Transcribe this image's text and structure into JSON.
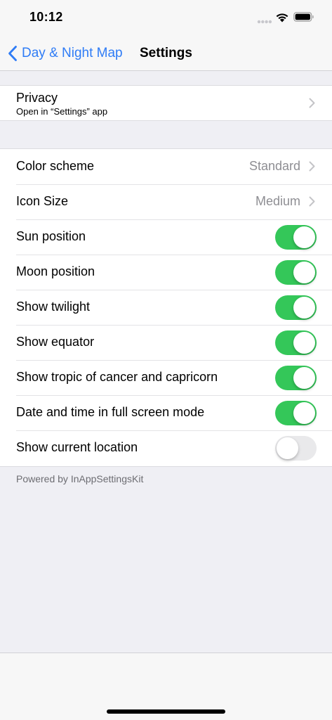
{
  "status_bar": {
    "time": "10:12"
  },
  "nav": {
    "back_label": "Day & Night Map",
    "title": "Settings"
  },
  "privacy": {
    "title": "Privacy",
    "subtitle": "Open in “Settings” app"
  },
  "settings": {
    "color_scheme": {
      "label": "Color scheme",
      "value": "Standard"
    },
    "icon_size": {
      "label": "Icon Size",
      "value": "Medium"
    },
    "toggles": [
      {
        "label": "Sun position",
        "on": true
      },
      {
        "label": "Moon position",
        "on": true
      },
      {
        "label": "Show twilight",
        "on": true
      },
      {
        "label": "Show equator",
        "on": true
      },
      {
        "label": "Show tropic of cancer and capricorn",
        "on": true
      },
      {
        "label": "Date and time in full screen mode",
        "on": true
      },
      {
        "label": "Show current location",
        "on": false
      }
    ]
  },
  "footer": {
    "text": "Powered by InAppSettingsKit"
  },
  "colors": {
    "accent": "#2f7cf6",
    "toggle_on": "#34c759",
    "toggle_off": "#e9e9eb",
    "background": "#efeff4"
  }
}
